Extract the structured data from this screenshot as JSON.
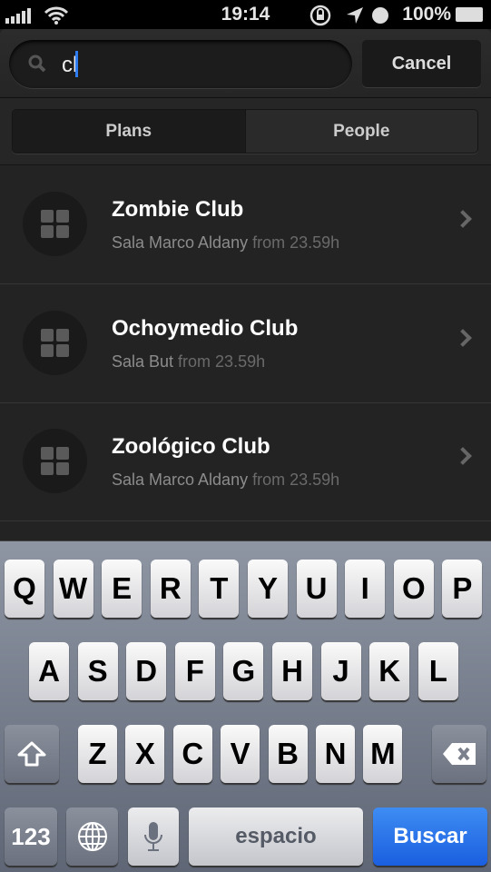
{
  "status_bar": {
    "time": "19:14",
    "battery": "100%"
  },
  "search": {
    "query": "cl",
    "cancel_label": "Cancel"
  },
  "tabs": [
    {
      "label": "Plans",
      "active": true
    },
    {
      "label": "People",
      "active": false
    }
  ],
  "results": [
    {
      "title": "Zombie Club",
      "venue": "Sala Marco Aldany",
      "time": "from 23.59h"
    },
    {
      "title": "Ochoymedio Club",
      "venue": "Sala But",
      "time": "from 23.59h"
    },
    {
      "title": "Zoológico Club",
      "venue": "Sala Marco Aldany",
      "time": "from 23.59h"
    }
  ],
  "keyboard": {
    "row1": [
      "Q",
      "W",
      "E",
      "R",
      "T",
      "Y",
      "U",
      "I",
      "O",
      "P"
    ],
    "row2": [
      "A",
      "S",
      "D",
      "F",
      "G",
      "H",
      "J",
      "K",
      "L"
    ],
    "row3": [
      "Z",
      "X",
      "C",
      "V",
      "B",
      "N",
      "M"
    ],
    "numbers_label": "123",
    "space_label": "espacio",
    "return_label": "Buscar",
    "return_color": "#1f66e5"
  }
}
